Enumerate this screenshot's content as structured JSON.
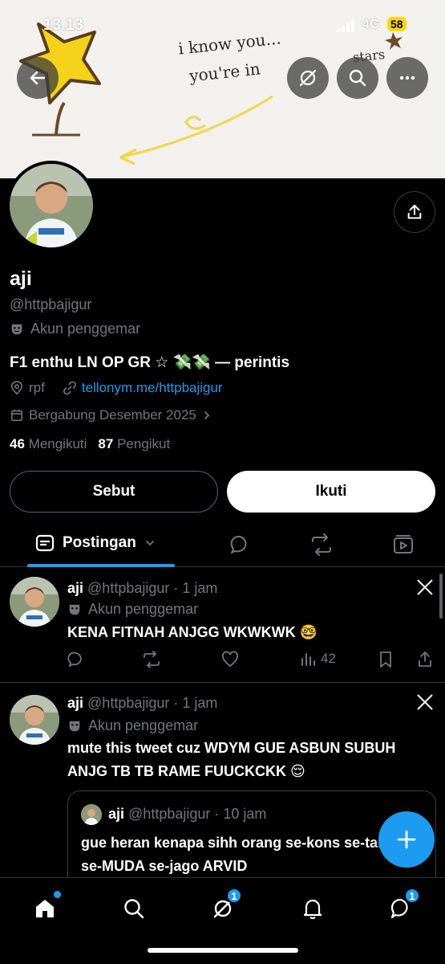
{
  "status_bar": {
    "time": "13.13",
    "network": "4G",
    "battery": "58"
  },
  "banner": {
    "line1": "i know you...",
    "line2": "you're in",
    "line3": "stars"
  },
  "profile": {
    "name": "aji",
    "handle": "@httpbajigur",
    "fan_label": "Akun penggemar",
    "bio": "F1 enthu LN OP GR ☆ 💸💸 — perintis",
    "location": "rpf",
    "link": "tellonym.me/httpbajigur",
    "joined": "Bergabung Desember 2025",
    "following_count": "46",
    "following_label": "Mengikuti",
    "followers_count": "87",
    "followers_label": "Pengikut",
    "mention_button": "Sebut",
    "follow_button": "Ikuti"
  },
  "tabs": {
    "posts_label": "Postingan"
  },
  "tweets": [
    {
      "name": "aji",
      "handle": "@httpbajigur",
      "time": "1 jam",
      "fan_label": "Akun penggemar",
      "text": "KENA FITNAH ANJGG WKWKWK 🤓",
      "views": "42"
    },
    {
      "name": "aji",
      "handle": "@httpbajigur",
      "time": "1 jam",
      "fan_label": "Akun penggemar",
      "text": "mute this tweet cuz WDYM GUE ASBUN SUBUH ANJG TB TB RAME FUUCKCKK 😌",
      "quote": {
        "name": "aji",
        "handle": "@httpbajigur",
        "time": "10 jam",
        "text": "gue heran kenapa sihh orang se-kons se-talented se-MUDA se-jago ARVID"
      }
    }
  ],
  "bottom_nav": {
    "search_badge": "1",
    "messages_badge": "1"
  },
  "colors": {
    "accent": "#1d9bf0",
    "background": "#000000",
    "muted": "#71767b"
  }
}
